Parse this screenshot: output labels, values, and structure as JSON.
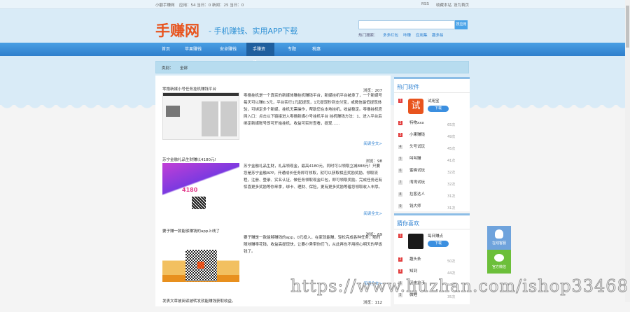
{
  "topbar": {
    "site": "小额手赚网",
    "stats": "应用：54 当日：0 新闻：25 当日：0",
    "rss": "RSS",
    "fav": "收藏本站",
    "home": "设为首页"
  },
  "header": {
    "logo": "手赚网",
    "slogan": "- 手机赚钱、实用APP下载",
    "search_btn": "搜应用",
    "search_placeholder": "",
    "hot_label": "热门搜索：",
    "hot": [
      "多多红包",
      "咔赚",
      "应用集",
      "趣多拍"
    ]
  },
  "nav": [
    "首页",
    "苹果赚钱",
    "安卓赚钱",
    "手赚资讯",
    "专题",
    "税惠"
  ],
  "crumb": {
    "label": "类别：",
    "value": "全部"
  },
  "articles": [
    {
      "title": "零撸新媒小号任务挂机赚钱平台",
      "views": "浏览：207",
      "desc": "零撸挂机是一个真实的新媒体赚挂机赚钱平台，新媒挂机平台被承了，一个新媒号每天可以赚0.5元，平台实行1元起提现，1元提现秒到支付宝，或微信最低提现体验，可绑定多个新媒，挂机无需操作，帮助您在本地挂机，收益稳定。零撸挂机官网入口：点击以下链接进入零撸新媒小号挂机平台 挂机赚钱方法：1、进入平台后绑定新媒账号即可开始挂机，收益可实时查看，提现……",
      "more": "阅读全文>"
    },
    {
      "title": "苏宁金融礼品生财赚以4180元!",
      "views": "浏览：98",
      "desc": "苏宁金融礼品生财，礼品领现金，最高4180元，同时可以领取立减888元！只要您是苏宁金融APP，开通成长任务即可领取，就可以获取相应奖励奖励。领取流程，注册、登录、实名认证，做任务领取现金红包，即可领取奖励。完成任务还有惊喜更多奖励等你来拿，绑卡、理财、保险，更有更多奖励等着您领取收入丰厚。",
      "more": "阅读全文>"
    },
    {
      "title": "要子赚一款能够赚钱的app上线了",
      "views": "浏览：69",
      "desc": "要子赚是一款能够赚钱的app，0元投入，在家就能赚，轻松完成各种任务，随时随地赚零花钱，收益高提现快，让要小秀带你们飞，从此再也不用担心明天的早饭钱了。",
      "more": "阅读全文>"
    },
    {
      "title": "发表文章被阅读被转发就能赚钱获取收益。",
      "views": "浏览：112"
    }
  ],
  "hot_apps": {
    "title": "热门软件",
    "top": {
      "name": "试用宝",
      "btn": "下载"
    },
    "items": [
      {
        "name": "特物xxx",
        "count": "65次"
      },
      {
        "name": "小果赚钱",
        "count": "49次"
      },
      {
        "name": "头号试玩",
        "count": "45次"
      },
      {
        "name": "叫叫赚",
        "count": "41次"
      },
      {
        "name": "蜜蜂试玩",
        "count": "32次"
      },
      {
        "name": "湾湾试玩",
        "count": "32次"
      },
      {
        "name": "拉客达人",
        "count": "31次"
      },
      {
        "name": "钱大师",
        "count": "31次"
      }
    ]
  },
  "guess": {
    "title": "猜你喜欢",
    "top": {
      "name": "每日赚点",
      "btn": "下载"
    },
    "items": [
      {
        "name": "趣头条",
        "count": "50次"
      },
      {
        "name": "知到",
        "count": "44次"
      },
      {
        "name": "闪电盒子",
        "count": "36次"
      },
      {
        "name": "微鲤",
        "count": "35次"
      }
    ]
  },
  "float": {
    "qq": "在线客服",
    "wechat": "官方微信"
  },
  "watermark": "https://www.huzhan.com/ishop33468",
  "colors": {
    "accent": "#2b7fd0",
    "logo": "#e8541e",
    "nav": "#3a8ed8",
    "wechat": "#6cbf3a"
  }
}
